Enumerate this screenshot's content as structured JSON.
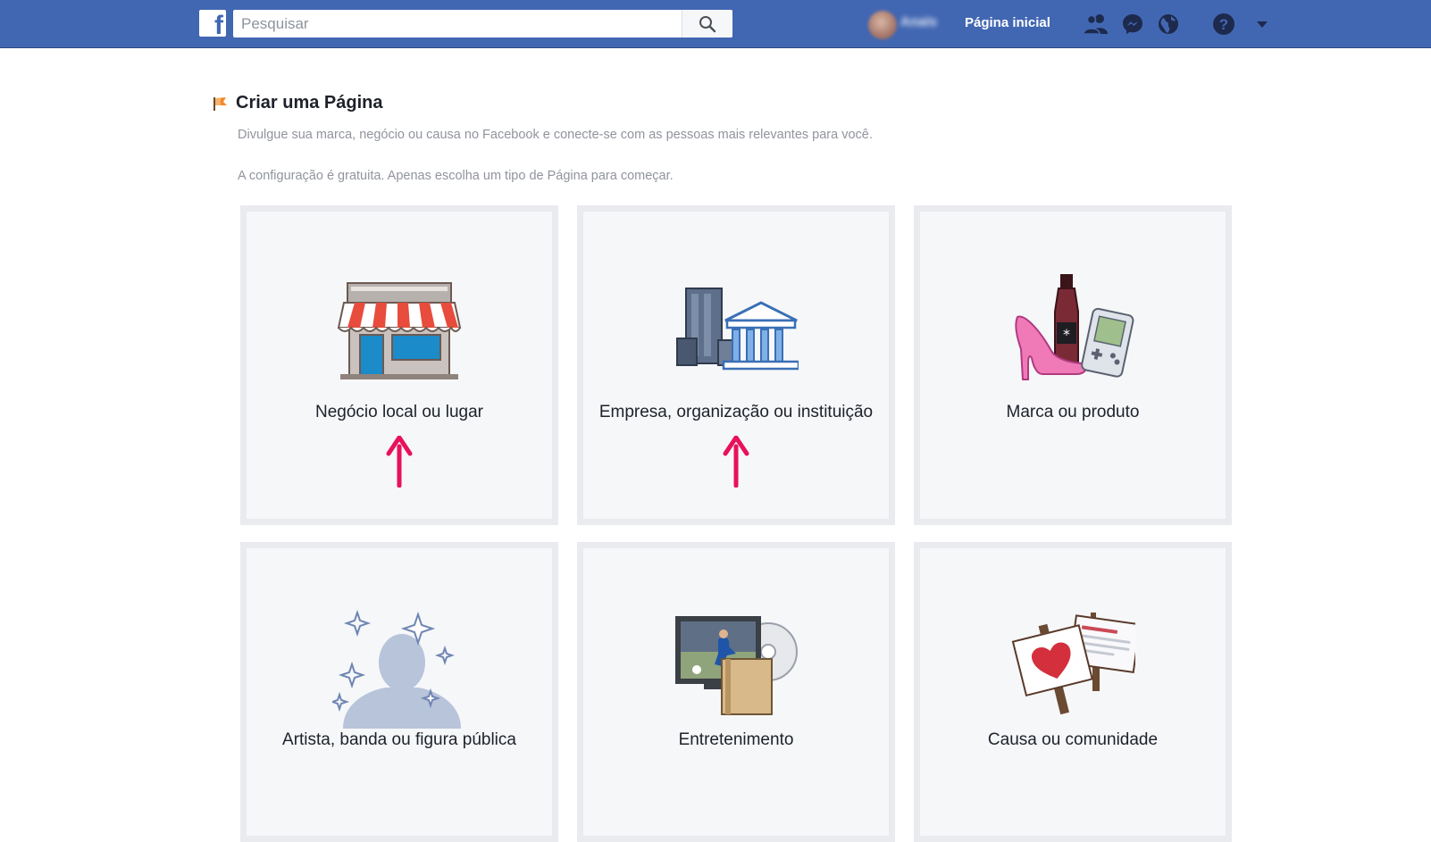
{
  "topbar": {
    "logo_letter": "f",
    "search_placeholder": "Pesquisar",
    "user_name": "Anaïs",
    "home_label": "Página inicial"
  },
  "page": {
    "title": "Criar uma Página",
    "description": "Divulgue sua marca, negócio ou causa no Facebook e conecte-se com as pessoas mais relevantes para você.",
    "subdescription": "A configuração é gratuita. Apenas escolha um tipo de Página para começar."
  },
  "categories": [
    {
      "label": "Negócio local ou lugar",
      "icon": "storefront-icon"
    },
    {
      "label": "Empresa, organização ou instituição",
      "icon": "buildings-icon"
    },
    {
      "label": "Marca ou produto",
      "icon": "products-icon"
    },
    {
      "label": "Artista, banda ou figura pública",
      "icon": "public-figure-icon"
    },
    {
      "label": "Entretenimento",
      "icon": "entertainment-icon"
    },
    {
      "label": "Causa ou comunidade",
      "icon": "cause-signs-icon"
    }
  ],
  "colors": {
    "brand": "#4267b2",
    "annotation_arrow": "#e8115a",
    "card_bg": "#f6f7f9",
    "card_border": "#e9ebee"
  }
}
